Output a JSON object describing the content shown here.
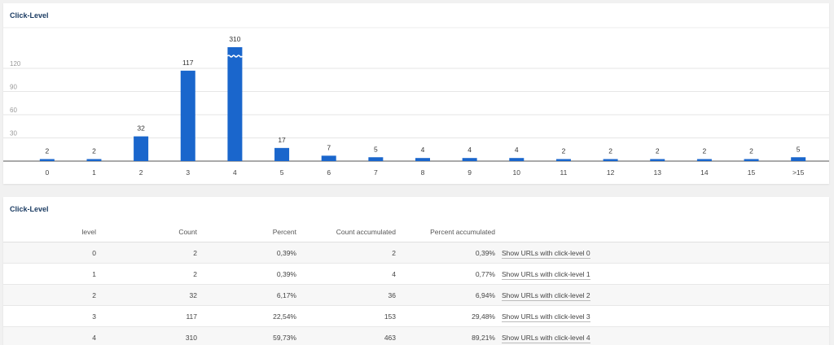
{
  "chart_title": "Click-Level",
  "table_title": "Click-Level",
  "colors": {
    "bar": "#1a66cc",
    "grid": "#e6e6e6",
    "title": "#1c3c63"
  },
  "chart_data": {
    "type": "bar",
    "categories": [
      "0",
      "1",
      "2",
      "3",
      "4",
      "5",
      "6",
      "7",
      "8",
      "9",
      "10",
      "11",
      "12",
      "13",
      "14",
      "15",
      ">15"
    ],
    "values": [
      2,
      2,
      32,
      117,
      310,
      17,
      7,
      5,
      4,
      4,
      4,
      2,
      2,
      2,
      2,
      2,
      5
    ],
    "data_labels": [
      "2",
      "2",
      "32",
      "117",
      "310",
      "17",
      "7",
      "5",
      "4",
      "4",
      "4",
      "2",
      "2",
      "2",
      "2",
      "2",
      "5"
    ],
    "yticks": [
      "30",
      "60",
      "90",
      "120"
    ],
    "ylim": [
      0,
      120
    ],
    "axis_break": true,
    "grid": true,
    "title": "Click-Level"
  },
  "table": {
    "headers": [
      "level",
      "Count",
      "Percent",
      "Count accumulated",
      "Percent accumulated"
    ],
    "rows": [
      {
        "level": "0",
        "count": "2",
        "percent": "0,39%",
        "count_acc": "2",
        "percent_acc": "0,39%",
        "link": "Show URLs with click-level 0"
      },
      {
        "level": "1",
        "count": "2",
        "percent": "0,39%",
        "count_acc": "4",
        "percent_acc": "0,77%",
        "link": "Show URLs with click-level 1"
      },
      {
        "level": "2",
        "count": "32",
        "percent": "6,17%",
        "count_acc": "36",
        "percent_acc": "6,94%",
        "link": "Show URLs with click-level 2"
      },
      {
        "level": "3",
        "count": "117",
        "percent": "22,54%",
        "count_acc": "153",
        "percent_acc": "29,48%",
        "link": "Show URLs with click-level 3"
      },
      {
        "level": "4",
        "count": "310",
        "percent": "59,73%",
        "count_acc": "463",
        "percent_acc": "89,21%",
        "link": "Show URLs with click-level 4"
      }
    ]
  }
}
